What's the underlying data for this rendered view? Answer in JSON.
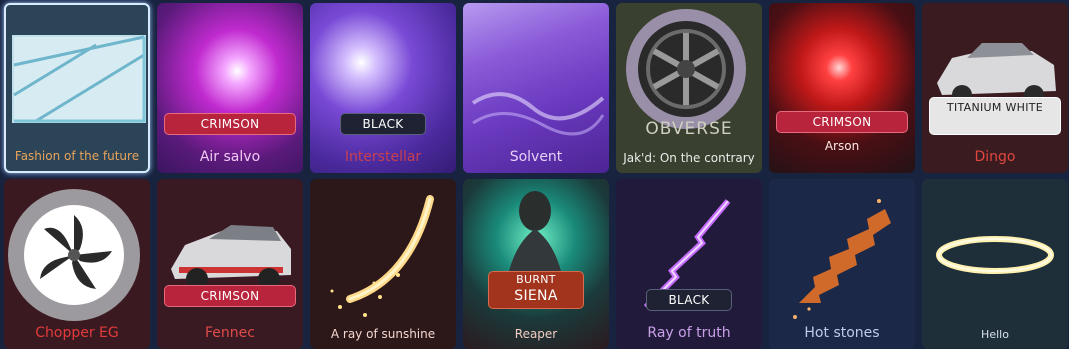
{
  "colors": {
    "background": "#17233f",
    "crimson": "#b8243c",
    "black_paint": "#1e2233",
    "titanium_white": "#e6e6e6",
    "burnt_siena": "#a2331c"
  },
  "items": [
    {
      "name": "Fashion of the future",
      "label_color": "#e9a35a",
      "icon": "glass-decal-icon"
    },
    {
      "name": "Air salvo",
      "paint": "CRIMSON",
      "label_color": "#f0c9f5",
      "icon": "explosion-boost-icon"
    },
    {
      "name": "Interstellar",
      "paint": "BLACK",
      "label_color": "#c8404e",
      "icon": "nebula-boost-icon"
    },
    {
      "name": "Solvent",
      "label_color": "#e6d0f5",
      "icon": "liquid-goal-explosion-icon"
    },
    {
      "name": "Jak'd: On the contrary",
      "overlay": "OBVERSE",
      "label_color": "#e7ede8",
      "icon": "wheel-rim-icon"
    },
    {
      "name": "Arson",
      "paint": "CRIMSON",
      "label_color": "#ffe6e2",
      "icon": "fire-orb-icon"
    },
    {
      "name": "Dingo",
      "paint": "TITANIUM WHITE",
      "label_color": "#e0463f",
      "icon": "car-body-icon"
    },
    {
      "name": "Chopper EG",
      "label_color": "#e23b3b",
      "icon": "turbine-wheel-icon"
    },
    {
      "name": "Fennec",
      "paint": "CRIMSON",
      "label_color": "#df4a4a",
      "icon": "car-body-icon"
    },
    {
      "name": "A ray of sunshine",
      "label_color": "#f4d6d0",
      "icon": "sparkle-trail-icon"
    },
    {
      "name": "Reaper",
      "paint_line1": "BURNT",
      "paint_line2": "SIENA",
      "label_color": "#f3ccc3",
      "icon": "reaper-avatar-icon"
    },
    {
      "name": "Ray of truth",
      "paint": "BLACK",
      "label_color": "#c8a0e8",
      "icon": "lightning-trail-icon"
    },
    {
      "name": "Hot stones",
      "label_color": "#bfcbe8",
      "icon": "ember-trail-icon"
    },
    {
      "name": "Hello",
      "label_color": "#d7e0ee",
      "icon": "halo-topper-icon"
    }
  ]
}
